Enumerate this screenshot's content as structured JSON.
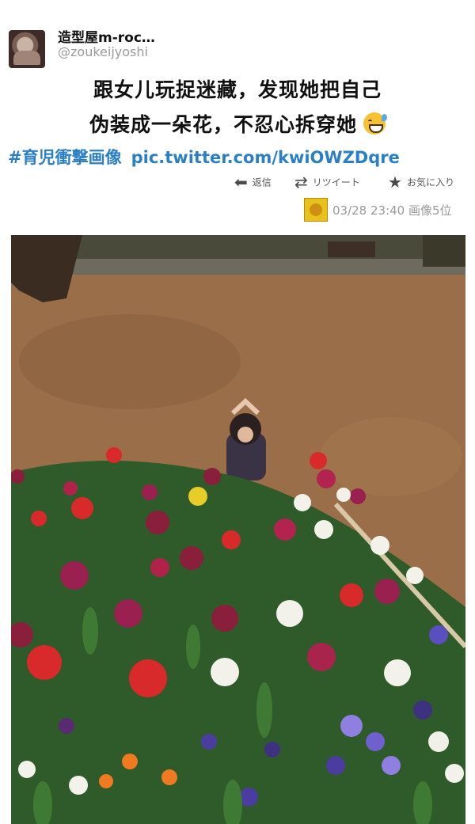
{
  "tweet": {
    "display_name": "造型屋m-roc…",
    "handle": "@zoukeijyoshi",
    "text_line1": "跟女儿玩捉迷藏，发现她把自己",
    "text_line2": "伪装成一朵花，不忍心拆穿她",
    "emoji": "sweat-smile-emoji",
    "hashtag": "#育児衝撃画像",
    "link": "pic.twitter.com/kwiOWZDqre"
  },
  "actions": {
    "reply_label": "返信",
    "retweet_label": "リツイート",
    "favorite_label": "お気に入り",
    "reply_icon": "reply-arrow-icon",
    "retweet_icon": "retweet-icon",
    "favorite_icon": "star-icon"
  },
  "meta": {
    "timestamp": "03/28 23:40 画像5位"
  },
  "photo": {
    "subject": "photo-girl-hiding-among-tulips"
  },
  "colors": {
    "link": "#2b7fc4",
    "muted": "#9a9a9a",
    "ground": "#9a6e49",
    "badge": "#e8c21c"
  }
}
